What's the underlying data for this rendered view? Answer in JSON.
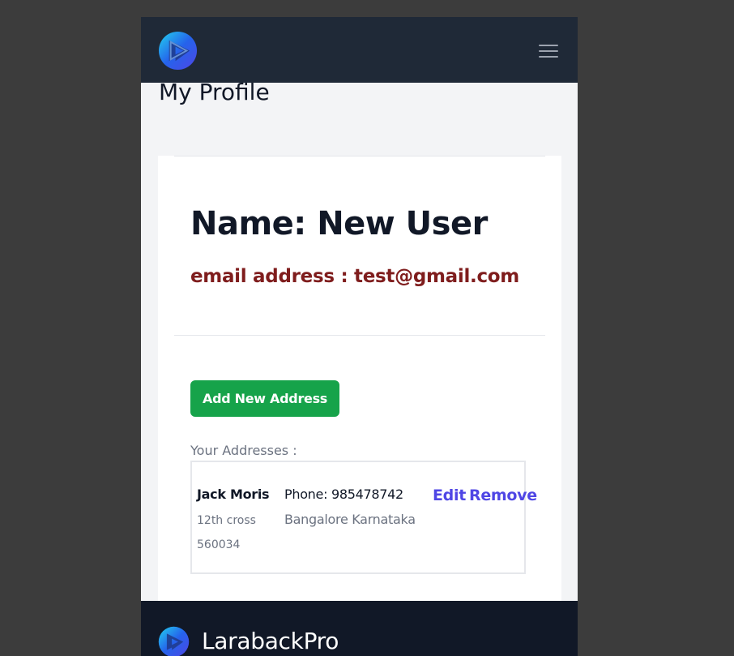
{
  "header": {
    "logo_icon": "laraback-logo-icon",
    "menu_icon": "hamburger-menu-icon"
  },
  "page": {
    "title": "My Profile"
  },
  "profile": {
    "name_line": "Name: New User",
    "email_line": "email address : test@gmail.com"
  },
  "actions": {
    "add_address_label": "Add New Address"
  },
  "addresses": {
    "section_label": "Your Addresses :",
    "items": [
      {
        "name": "Jack Moris",
        "street": "12th cross",
        "pincode": "560034",
        "phone": "Phone: 985478742",
        "city_state": "Bangalore Karnataka",
        "edit_label": "Edit",
        "remove_label": "Remove"
      }
    ]
  },
  "footer": {
    "brand": "LarabackPro"
  },
  "colors": {
    "page_background": "#3c3c3c",
    "header_background": "#1f2937",
    "content_background": "#f3f4f6",
    "footer_background": "#111827",
    "email_color": "#7f1d1d",
    "primary_button": "#16a34a",
    "link_color": "#4f46e5"
  }
}
